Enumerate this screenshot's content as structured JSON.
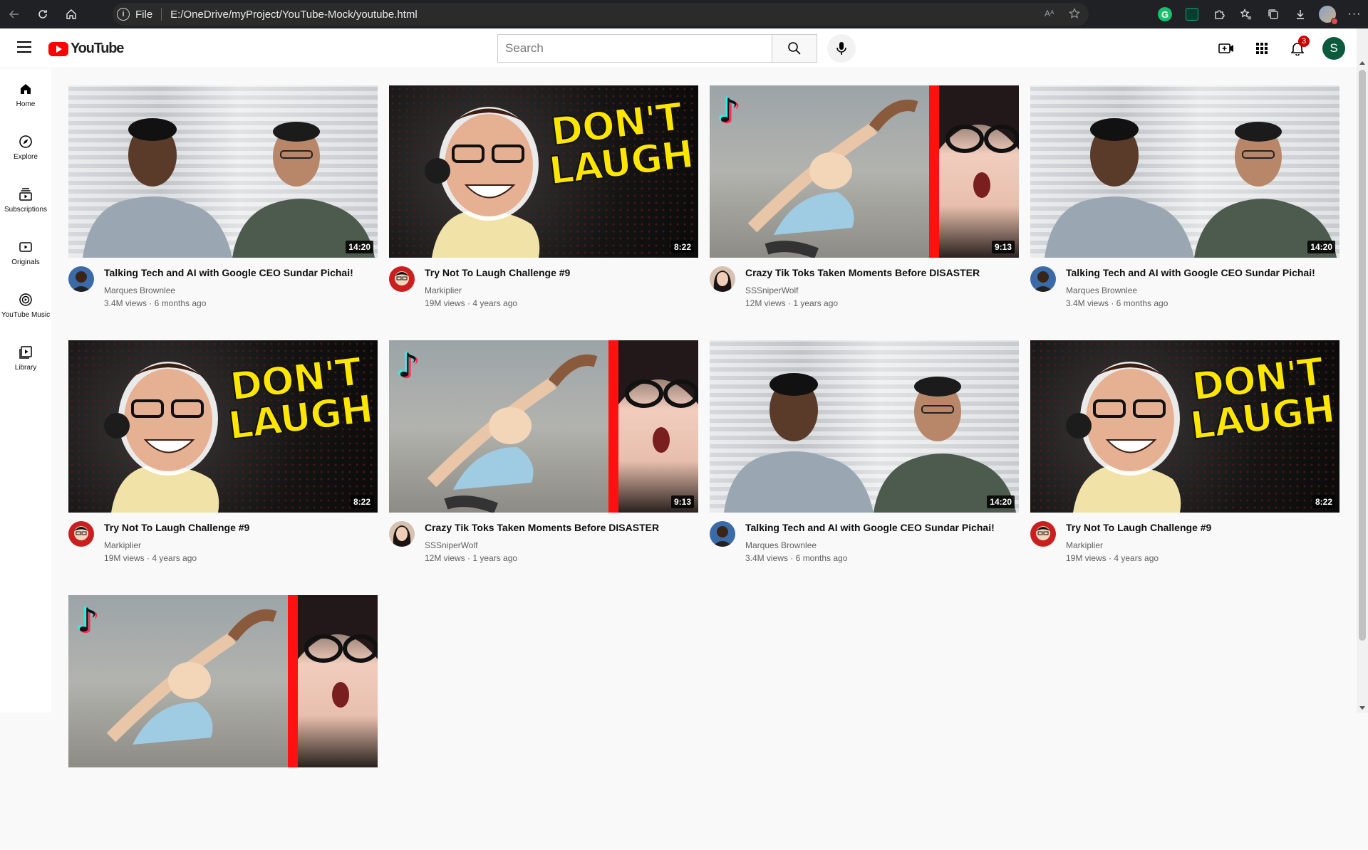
{
  "browser": {
    "scheme_label": "File",
    "url": "E:/OneDrive/myProject/YouTube-Mock/youtube.html"
  },
  "header": {
    "logo_text": "YouTube",
    "search_placeholder": "Search",
    "notification_count": "3",
    "user_initial": "S"
  },
  "sidebar": {
    "items": [
      {
        "label": "Home",
        "icon": "home-icon"
      },
      {
        "label": "Explore",
        "icon": "compass-icon"
      },
      {
        "label": "Subscriptions",
        "icon": "subscriptions-icon"
      },
      {
        "label": "Originals",
        "icon": "originals-icon"
      },
      {
        "label": "YouTube Music",
        "icon": "music-icon"
      },
      {
        "label": "Library",
        "icon": "library-icon"
      }
    ]
  },
  "videos": [
    {
      "title": "Talking Tech and AI with Google CEO Sundar Pichai!",
      "channel": "Marques Brownlee",
      "stats": "3.4M views · 6 months ago",
      "duration": "14:20"
    },
    {
      "title": "Try Not To Laugh Challenge #9",
      "channel": "Markiplier",
      "stats": "19M views · 4 years ago",
      "duration": "8:22"
    },
    {
      "title": "Crazy Tik Toks Taken Moments Before DISASTER",
      "channel": "SSSniperWolf",
      "stats": "12M views · 1 years ago",
      "duration": "9:13"
    },
    {
      "title": "Talking Tech and AI with Google CEO Sundar Pichai!",
      "channel": "Marques Brownlee",
      "stats": "3.4M views · 6 months ago",
      "duration": "14:20"
    },
    {
      "title": "Try Not To Laugh Challenge #9",
      "channel": "Markiplier",
      "stats": "19M views · 4 years ago",
      "duration": "8:22"
    },
    {
      "title": "Crazy Tik Toks Taken Moments Before DISASTER",
      "channel": "SSSniperWolf",
      "stats": "12M views · 1 years ago",
      "duration": "9:13"
    },
    {
      "title": "Talking Tech and AI with Google CEO Sundar Pichai!",
      "channel": "Marques Brownlee",
      "stats": "3.4M views · 6 months ago",
      "duration": "14:20"
    },
    {
      "title": "Try Not To Laugh Challenge #9",
      "channel": "Markiplier",
      "stats": "19M views · 4 years ago",
      "duration": "8:22"
    }
  ],
  "thumbnail_text": {
    "laugh_line1": "DON'T",
    "laugh_line2": "LAUGH"
  },
  "colors": {
    "brand_red": "#ff0000",
    "notification_red": "#cc0000",
    "avatar_green": "#0b5a3c"
  }
}
